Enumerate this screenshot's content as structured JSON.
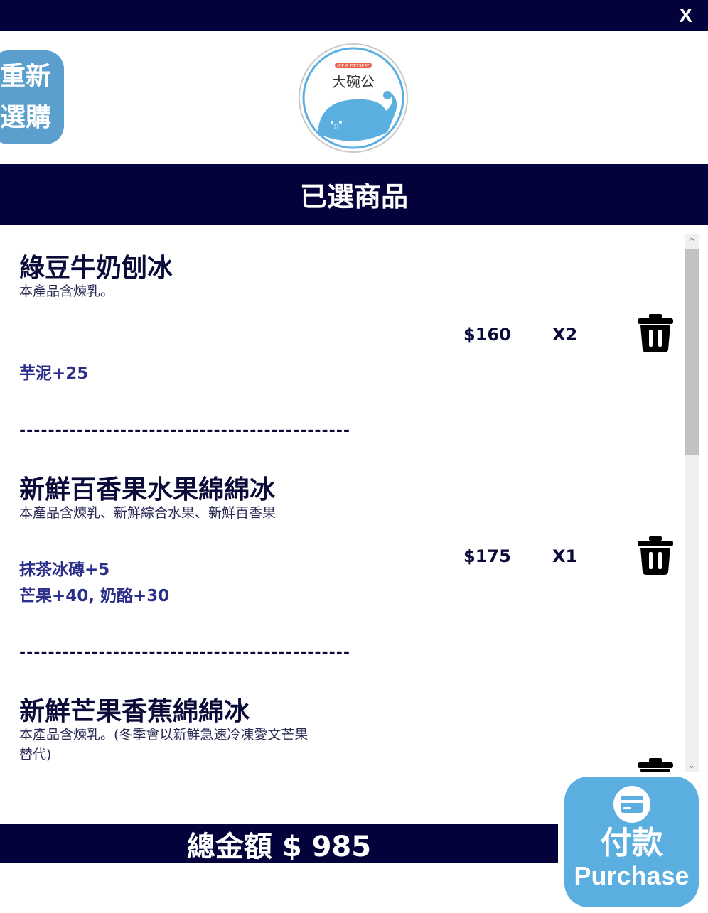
{
  "top_bar": {
    "close_label": "X"
  },
  "reset_button": {
    "line1": "重新",
    "line2": "選購"
  },
  "logo": {
    "text": "大碗公",
    "tag": "ICE & DESSERT"
  },
  "section_title": "已選商品",
  "items": [
    {
      "name": "綠豆牛奶刨冰",
      "desc": "本產品含煉乳。",
      "options": [
        "芋泥+25"
      ],
      "price": "$160",
      "qty": "X2"
    },
    {
      "name": "新鮮百香果水果綿綿冰",
      "desc": "本產品含煉乳、新鮮綜合水果、新鮮百香果",
      "options": [
        "抹茶冰磚+5",
        "芒果+40, 奶酪+30"
      ],
      "price": "$175",
      "qty": "X1"
    },
    {
      "name": "新鮮芒果香蕉綿綿冰",
      "desc": "本產品含煉乳。(冬季會以新鮮急速冷凍愛文芒果替代)",
      "options": [],
      "price": "",
      "qty": ""
    }
  ],
  "divider": "----------------------------------------------",
  "total": "總金額 $ 985",
  "pay_button": {
    "zh": "付款",
    "en": "Purchase"
  },
  "colors": {
    "navy": "#03023a",
    "button_blue": "#5b9fcf",
    "pay_blue": "#5aaee0",
    "option_text": "#2b2f8a"
  },
  "icons": {
    "delete": "trash-icon",
    "pay": "credit-card-icon",
    "close": "close-icon"
  }
}
